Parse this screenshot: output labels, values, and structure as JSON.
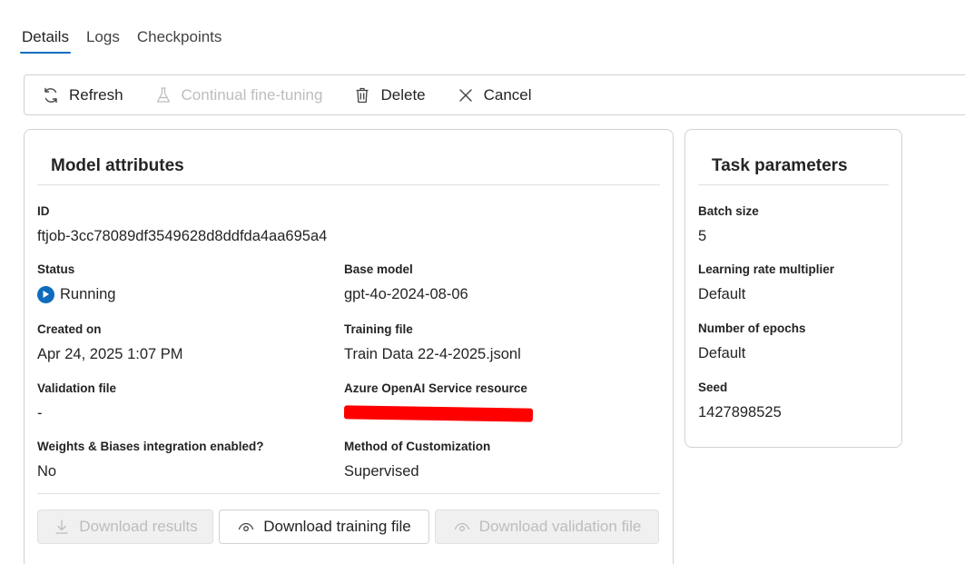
{
  "tabs": [
    {
      "label": "Details",
      "active": true
    },
    {
      "label": "Logs",
      "active": false
    },
    {
      "label": "Checkpoints",
      "active": false
    }
  ],
  "toolbar": {
    "refresh": {
      "label": "Refresh",
      "icon": "refresh-icon",
      "enabled": true
    },
    "continual": {
      "label": "Continual fine-tuning",
      "icon": "flask-icon",
      "enabled": false
    },
    "delete": {
      "label": "Delete",
      "icon": "trash-icon",
      "enabled": true
    },
    "cancel": {
      "label": "Cancel",
      "icon": "close-icon",
      "enabled": true
    }
  },
  "model_attributes": {
    "title": "Model attributes",
    "id": {
      "label": "ID",
      "value": "ftjob-3cc78089df3549628d8ddfda4aa695a4"
    },
    "status": {
      "label": "Status",
      "value": "Running",
      "icon": "play-icon",
      "color": "#0f6cbd"
    },
    "base_model": {
      "label": "Base model",
      "value": "gpt-4o-2024-08-06"
    },
    "created_on": {
      "label": "Created on",
      "value": "Apr 24, 2025 1:07 PM"
    },
    "training_file": {
      "label": "Training file",
      "value": "Train Data 22-4-2025.jsonl"
    },
    "validation_file": {
      "label": "Validation file",
      "value": "-"
    },
    "azure_resource": {
      "label": "Azure OpenAI Service resource",
      "value": "",
      "redacted": true
    },
    "wandb": {
      "label": "Weights & Biases integration enabled?",
      "value": "No"
    },
    "method": {
      "label": "Method of Customization",
      "value": "Supervised"
    }
  },
  "actions": {
    "download_results": {
      "label": "Download results",
      "icon": "download-icon",
      "enabled": false
    },
    "download_training": {
      "label": "Download training file",
      "icon": "eye-icon",
      "enabled": true
    },
    "download_validation": {
      "label": "Download validation file",
      "icon": "eye-icon",
      "enabled": false
    }
  },
  "task_parameters": {
    "title": "Task parameters",
    "batch_size": {
      "label": "Batch size",
      "value": "5"
    },
    "lr_multiplier": {
      "label": "Learning rate multiplier",
      "value": "Default"
    },
    "epochs": {
      "label": "Number of epochs",
      "value": "Default"
    },
    "seed": {
      "label": "Seed",
      "value": "1427898525"
    }
  },
  "colors": {
    "accent": "#0f6cbd",
    "redaction": "#ff0000"
  }
}
